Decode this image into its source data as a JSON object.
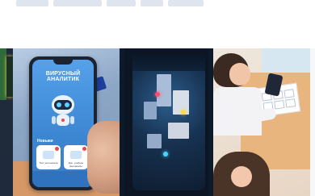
{
  "gallery": {
    "photo1": {
      "app": {
        "title": "ВИРУСНЫЙ АНАЛИТИК",
        "section": "Новыки",
        "cards": [
          {
            "label": "Тест для начала ...",
            "icon": "monitor-icon"
          },
          {
            "label": "Доп. учебное материалы",
            "icon": "doc-icon"
          }
        ]
      }
    },
    "photo2": {},
    "photo3": {}
  },
  "colors": {
    "app_blue": "#3c86d2",
    "app_blue_light": "#56a1ea",
    "desk": "#d59866"
  }
}
